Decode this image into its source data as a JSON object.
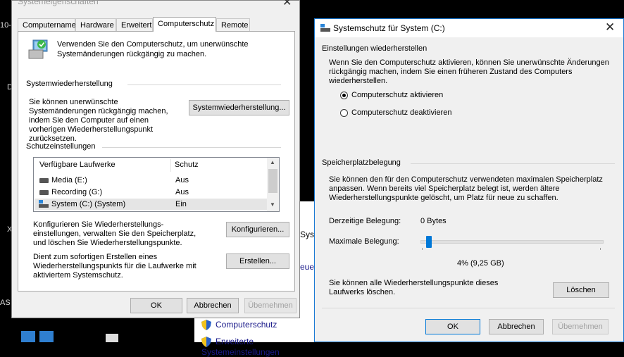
{
  "background": {
    "left_fragments": [
      "10-",
      "D",
      "X",
      "AS"
    ],
    "explorer_fragments": [
      "Sys",
      "euen"
    ],
    "explorer_items": [
      "Computerschutz",
      "Erweiterte Systemeinstellungen"
    ]
  },
  "sysprops": {
    "title": "Systemeigenschaften",
    "tabs": [
      "Computername",
      "Hardware",
      "Erweitert",
      "Computerschutz",
      "Remote"
    ],
    "active_tab": "Computerschutz",
    "intro": "Verwenden Sie den Computerschutz, um unerwünschte Systemänderungen rückgängig zu machen.",
    "restore_heading": "Systemwiederherstellung",
    "restore_desc": "Sie können unerwünschte Systemänderungen rückgängig machen, indem Sie den Computer auf einen vorherigen Wiederherstellungspunkt zurücksetzen.",
    "restore_button": "Systemwiederherstellung...",
    "protection_heading": "Schutzeinstellungen",
    "drives_header": {
      "drive": "Verfügbare Laufwerke",
      "protection": "Schutz"
    },
    "drives": [
      {
        "name": "Media (E:)",
        "protection": "Aus",
        "icon": "hard-drive-icon"
      },
      {
        "name": "Recording (G:)",
        "protection": "Aus",
        "icon": "hard-drive-icon"
      },
      {
        "name": "System (C:) (System)",
        "protection": "Ein",
        "icon": "system-drive-icon",
        "selected": true
      }
    ],
    "configure_desc": "Konfigurieren Sie Wiederherstellungs- einstellungen, verwalten Sie den Speicherplatz, und löschen Sie Wiederherstellungspunkte.",
    "configure_button": "Konfigurieren...",
    "create_desc": "Dient zum sofortigen Erstellen eines Wiederherstellungspunkts für die Laufwerke mit aktiviertem Systemschutz.",
    "create_button": "Erstellen...",
    "ok": "OK",
    "cancel": "Abbrechen",
    "apply": "Übernehmen"
  },
  "syscfg": {
    "title": "Systemschutz für System (C:)",
    "restore_heading": "Einstellungen wiederherstellen",
    "restore_desc": "Wenn Sie den Computerschutz aktivieren, können Sie unerwünschte Änderungen rückgängig machen, indem Sie einen früheren Zustand des Computers wiederherstellen.",
    "options": [
      {
        "label": "Computerschutz aktivieren",
        "selected": true
      },
      {
        "label": "Computerschutz deaktivieren",
        "selected": false
      }
    ],
    "disk_heading": "Speicherplatzbelegung",
    "disk_desc": "Sie können den für den Computerschutz verwendeten maximalen Speicherplatz anpassen. Wenn bereits viel Speicherplatz belegt ist, werden ältere Wiederherstellungspunkte gelöscht, um Platz für neue zu schaffen.",
    "current_label": "Derzeitige Belegung:",
    "current_value": "0 Bytes",
    "max_label": "Maximale Belegung:",
    "max_percent": 4,
    "max_text": "4% (9,25 GB)",
    "delete_desc": "Sie können alle Wiederherstellungspunkte dieses Laufwerks löschen.",
    "delete_button": "Löschen",
    "ok": "OK",
    "cancel": "Abbrechen",
    "apply": "Übernehmen"
  },
  "colors": {
    "accent": "#0078d7",
    "dialog_bg": "#f0f0f0"
  }
}
